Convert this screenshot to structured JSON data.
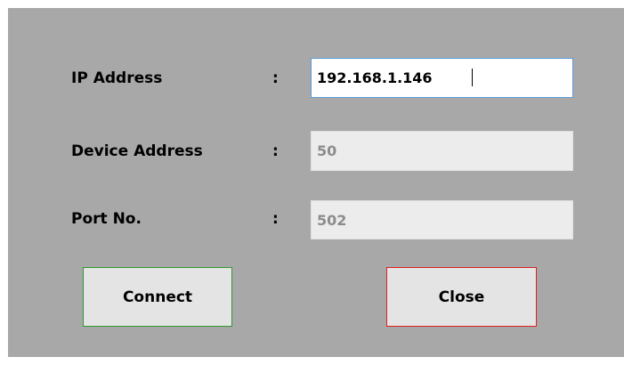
{
  "form": {
    "ip_address": {
      "label": "IP Address",
      "separator": ":",
      "value": "192.168.1.146"
    },
    "device_address": {
      "label": "Device Address",
      "separator": ":",
      "value": "50"
    },
    "port_no": {
      "label": "Port No.",
      "separator": ":",
      "value": "502"
    }
  },
  "buttons": {
    "connect_label": "Connect",
    "close_label": "Close",
    "connect_border_color": "#2e9a2e",
    "close_border_color": "#e02020"
  },
  "colors": {
    "background": "#a8a8a8",
    "focus_border": "#5b9bd5"
  }
}
